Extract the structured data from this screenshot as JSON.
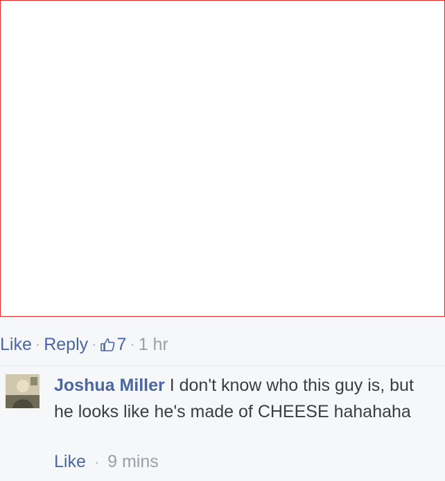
{
  "post_image": {
    "icon": "image-placeholder"
  },
  "top_comment_actions": {
    "like_label": "Like",
    "separator": "·",
    "reply_label": "Reply",
    "like_count": "7",
    "like_count_icon": "thumbs-up-icon",
    "timestamp": "1 hr"
  },
  "reply": {
    "author": "Joshua Miller",
    "text": "I don't know who this guy is, but he looks like he's made of CHEESE hahahaha",
    "avatar_icon": "avatar",
    "like_label": "Like",
    "separator": "·",
    "timestamp": "9 mins"
  },
  "colors": {
    "link": "#4b67a1",
    "muted": "#9aa0a8",
    "text": "#3a3d42",
    "image_border": "#e0282a",
    "background": "#f6f7f9"
  }
}
